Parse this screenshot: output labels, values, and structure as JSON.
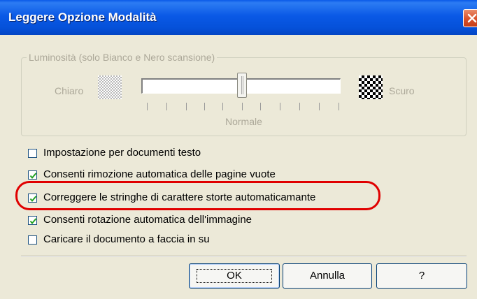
{
  "window": {
    "title": "Leggere Opzione Modalità"
  },
  "brightness": {
    "group_label": "Luminosità (solo Bianco e Nero scansione)",
    "light_label": "Chiaro",
    "dark_label": "Scuro",
    "center_label": "Normale",
    "value_fraction": 0.5
  },
  "options": [
    {
      "label": "Impostazione  per documenti testo",
      "checked": false
    },
    {
      "label": "Consenti rimozione automatica delle pagine vuote",
      "checked": true
    },
    {
      "label": "Correggere le stringhe di carattere storte automaticamante",
      "checked": true
    },
    {
      "label": "Consenti rotazione automatica dell'immagine",
      "checked": true
    },
    {
      "label": "Caricare il documento a faccia in su",
      "checked": false
    }
  ],
  "buttons": {
    "ok": "OK",
    "cancel": "Annulla",
    "help": "?"
  },
  "colors": {
    "highlight": "#e00000",
    "titlebar": "#0a59e6"
  }
}
